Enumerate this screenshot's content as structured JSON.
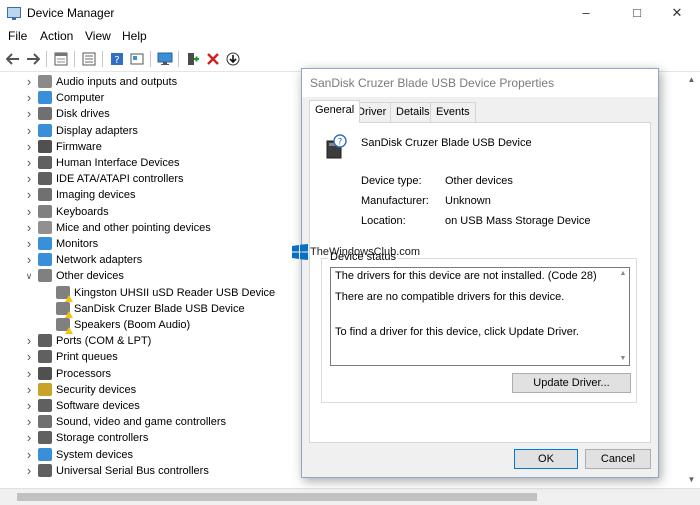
{
  "window": {
    "title": "Device Manager"
  },
  "menu": [
    "File",
    "Action",
    "View",
    "Help"
  ],
  "toolbar": {
    "icons": [
      "back-arrow-icon",
      "forward-arrow-icon",
      "properties-icon",
      "list-icon",
      "help-icon",
      "details-icon",
      "monitor-icon",
      "add-driver-icon",
      "uninstall-x-icon",
      "download-icon"
    ]
  },
  "tree": {
    "items": [
      {
        "label": "Audio inputs and outputs",
        "level": 1,
        "expanded": false,
        "icon": "speaker-icon",
        "color": "#8a8a8a"
      },
      {
        "label": "Computer",
        "level": 1,
        "expanded": false,
        "icon": "computer-icon",
        "color": "#3a8fd9"
      },
      {
        "label": "Disk drives",
        "level": 1,
        "expanded": false,
        "icon": "disk-icon",
        "color": "#707070"
      },
      {
        "label": "Display adapters",
        "level": 1,
        "expanded": false,
        "icon": "display-icon",
        "color": "#3a8fd9"
      },
      {
        "label": "Firmware",
        "level": 1,
        "expanded": false,
        "icon": "chip-icon",
        "color": "#505050"
      },
      {
        "label": "Human Interface Devices",
        "level": 1,
        "expanded": false,
        "icon": "hid-icon",
        "color": "#606060"
      },
      {
        "label": "IDE ATA/ATAPI controllers",
        "level": 1,
        "expanded": false,
        "icon": "controller-icon",
        "color": "#606060"
      },
      {
        "label": "Imaging devices",
        "level": 1,
        "expanded": false,
        "icon": "camera-icon",
        "color": "#707070"
      },
      {
        "label": "Keyboards",
        "level": 1,
        "expanded": false,
        "icon": "keyboard-icon",
        "color": "#808080"
      },
      {
        "label": "Mice and other pointing devices",
        "level": 1,
        "expanded": false,
        "icon": "mouse-icon",
        "color": "#909090"
      },
      {
        "label": "Monitors",
        "level": 1,
        "expanded": false,
        "icon": "monitor-icon",
        "color": "#3a8fd9"
      },
      {
        "label": "Network adapters",
        "level": 1,
        "expanded": false,
        "icon": "network-icon",
        "color": "#3a8fd9"
      },
      {
        "label": "Other devices",
        "level": 1,
        "expanded": true,
        "icon": "unknown-device-icon",
        "color": "#808080"
      },
      {
        "label": "Kingston UHSII uSD Reader USB Device",
        "level": 2,
        "expanded": null,
        "icon": "warning-device-icon",
        "color": "#808080",
        "warning": true
      },
      {
        "label": "SanDisk Cruzer Blade USB Device",
        "level": 2,
        "expanded": null,
        "icon": "warning-device-icon",
        "color": "#808080",
        "warning": true
      },
      {
        "label": "Speakers (Boom Audio)",
        "level": 2,
        "expanded": null,
        "icon": "warning-device-icon",
        "color": "#808080",
        "warning": true
      },
      {
        "label": "Ports (COM & LPT)",
        "level": 1,
        "expanded": false,
        "icon": "port-icon",
        "color": "#606060"
      },
      {
        "label": "Print queues",
        "level": 1,
        "expanded": false,
        "icon": "printer-icon",
        "color": "#606060"
      },
      {
        "label": "Processors",
        "level": 1,
        "expanded": false,
        "icon": "processor-icon",
        "color": "#505050"
      },
      {
        "label": "Security devices",
        "level": 1,
        "expanded": false,
        "icon": "key-icon",
        "color": "#c9a227"
      },
      {
        "label": "Software devices",
        "level": 1,
        "expanded": false,
        "icon": "software-icon",
        "color": "#606060"
      },
      {
        "label": "Sound, video and game controllers",
        "level": 1,
        "expanded": false,
        "icon": "sound-icon",
        "color": "#707070"
      },
      {
        "label": "Storage controllers",
        "level": 1,
        "expanded": false,
        "icon": "storage-icon",
        "color": "#606060"
      },
      {
        "label": "System devices",
        "level": 1,
        "expanded": false,
        "icon": "system-icon",
        "color": "#3a8fd9"
      },
      {
        "label": "Universal Serial Bus controllers",
        "level": 1,
        "expanded": false,
        "icon": "usb-icon",
        "color": "#606060"
      }
    ]
  },
  "dialog": {
    "title": "SanDisk Cruzer Blade USB Device Properties",
    "tabs": [
      "General",
      "Driver",
      "Details",
      "Events"
    ],
    "active_tab": "General",
    "device_name": "SanDisk Cruzer Blade USB Device",
    "properties": [
      {
        "label": "Device type:",
        "value": "Other devices"
      },
      {
        "label": "Manufacturer:",
        "value": "Unknown"
      },
      {
        "label": "Location:",
        "value": "on USB Mass Storage Device"
      }
    ],
    "status_group": "Device status",
    "status_lines": [
      "The drivers for this device are not installed. (Code 28)",
      "There are no compatible drivers for this device.",
      "To find a driver for this device, click Update Driver."
    ],
    "update_button": "Update Driver...",
    "ok_button": "OK",
    "cancel_button": "Cancel"
  },
  "watermark": {
    "text": "TheWindowsClub.com"
  },
  "colors": {
    "accent": "#0078d7",
    "warning": "#f2c40f",
    "error": "#d21f1f",
    "link_blue": "#3a8fd9"
  }
}
